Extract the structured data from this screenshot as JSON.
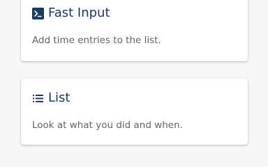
{
  "cards": [
    {
      "title": "Fast Input",
      "description": "Add time entries to the list.",
      "icon": "terminal-icon"
    },
    {
      "title": "List",
      "description": "Look at what you did and when.",
      "icon": "list-icon"
    }
  ],
  "colors": {
    "title": "#1b3a63",
    "text": "#5f6368",
    "background": "#f7f7f8",
    "card": "#ffffff"
  }
}
